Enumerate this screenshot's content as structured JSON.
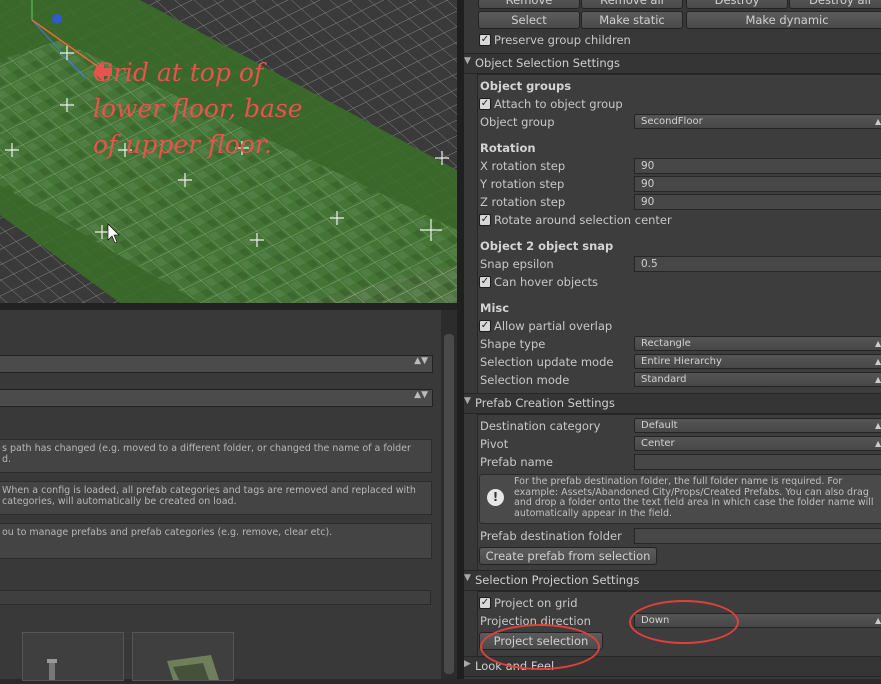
{
  "viewport": {
    "annotation": [
      "Grid at top of",
      "lower floor, base",
      "of upper floor."
    ]
  },
  "left_panel": {
    "help1": "s path has changed (e.g. moved to a different folder, or changed the name of a folder\nd.",
    "help2": " When a config is loaded, all prefab categories and tags are removed and replaced with\ncategories, will automatically be created on load.",
    "help3": "ou to manage prefabs and prefab categories (e.g. remove, clear etc)."
  },
  "group_buttons": {
    "remove": "Remove",
    "remove_all": "Remove all",
    "destroy": "Destroy",
    "destroy_all": "Destroy all",
    "select": "Select",
    "make_static": "Make static",
    "make_dynamic": "Make dynamic",
    "preserve_children": "Preserve group children"
  },
  "object_selection": {
    "header": "Object Selection Settings",
    "object_groups_title": "Object groups",
    "attach_label": "Attach to object group",
    "object_group_label": "Object group",
    "object_group_value": "SecondFloor",
    "rotation_title": "Rotation",
    "x_label": "X rotation step",
    "x_value": "90",
    "y_label": "Y rotation step",
    "y_value": "90",
    "z_label": "Z rotation step",
    "z_value": "90",
    "rotate_center_label": "Rotate around selection center",
    "snap_title": "Object 2 object snap",
    "snap_epsilon_label": "Snap epsilon",
    "snap_epsilon_value": "0.5",
    "can_hover_label": "Can hover objects",
    "misc_title": "Misc",
    "allow_overlap_label": "Allow partial overlap",
    "shape_type_label": "Shape type",
    "shape_type_value": "Rectangle",
    "update_mode_label": "Selection update mode",
    "update_mode_value": "Entire Hierarchy",
    "selection_mode_label": "Selection mode",
    "selection_mode_value": "Standard"
  },
  "prefab_creation": {
    "header": "Prefab Creation Settings",
    "dest_category_label": "Destination category",
    "dest_category_value": "Default",
    "pivot_label": "Pivot",
    "pivot_value": "Center",
    "prefab_name_label": "Prefab name",
    "prefab_name_value": "",
    "help_text": "For the prefab destination folder, the full folder name is required. For example: Assets/Abandoned City/Props/Created Prefabs. You can also drag and drop a folder onto the text field area in which case the folder name will automatically appear in the field.",
    "dest_folder_label": "Prefab destination folder",
    "dest_folder_value": "",
    "create_button": "Create prefab from selection"
  },
  "selection_projection": {
    "header": "Selection Projection Settings",
    "project_on_grid_label": "Project on grid",
    "direction_label": "Projection direction",
    "direction_value": "Down",
    "project_button": "Project selection"
  },
  "look_and_feel": {
    "header": "Look and Feel"
  },
  "colors": {
    "annotation": "#e8524f",
    "grid_green": "#3f6e2c",
    "panel_bg": "#383838"
  }
}
